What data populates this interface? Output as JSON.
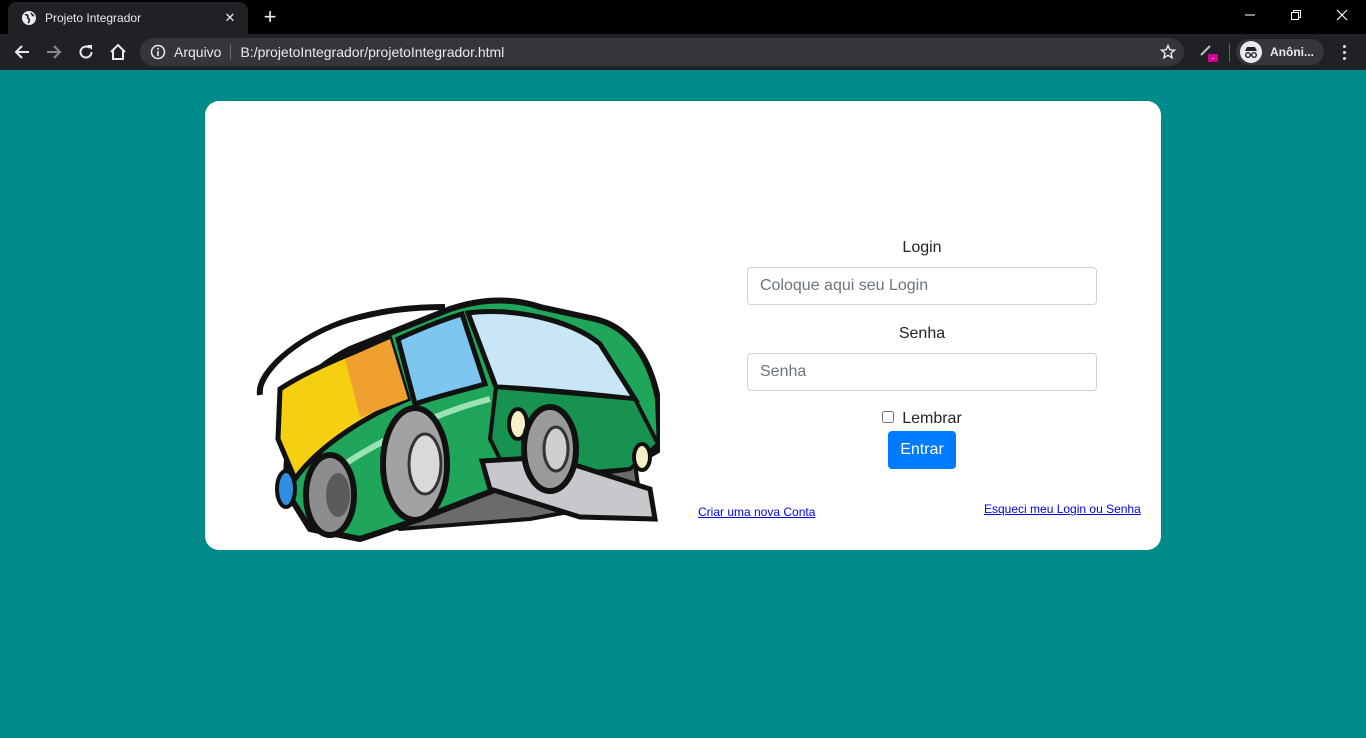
{
  "browser": {
    "tab_title": "Projeto Integrador",
    "tab_close": "✕",
    "new_tab": "+",
    "security_label": "Arquivo",
    "url": "B:/projetoIntegrador/projetoIntegrador.html",
    "profile_name": "Anôni..."
  },
  "login": {
    "label": "Login",
    "placeholder": "Coloque aqui seu Login"
  },
  "password": {
    "label": "Senha",
    "placeholder": "Senha"
  },
  "remember_label": "Lembrar",
  "submit_label": "Entrar",
  "links": {
    "create_account": "Criar uma nova Conta",
    "forgot": "Esqueci meu Login ou Senha"
  },
  "colors": {
    "page_background": "#008b8b",
    "card_background": "#ffffff",
    "primary_button": "#007bff",
    "link": "#0000ee"
  }
}
